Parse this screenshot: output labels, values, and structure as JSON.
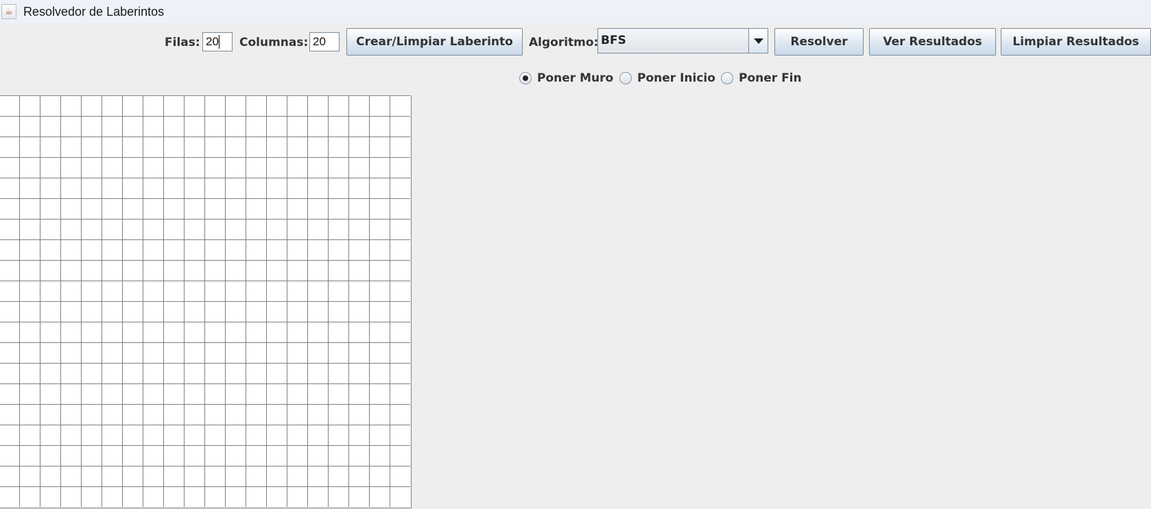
{
  "window": {
    "title": "Resolvedor de Laberintos",
    "icon": "java-cup-icon"
  },
  "toolbar": {
    "rows_label": "Filas:",
    "rows_value": "20",
    "cols_label": "Columnas:",
    "cols_value": "20",
    "create_label": "Crear/Limpiar Laberinto",
    "algo_label": "Algoritmo:",
    "algo_value": "BFS",
    "solve_label": "Resolver",
    "results_label": "Ver Resultados",
    "clear_results_label": "Limpiar Resultados"
  },
  "modes": {
    "selected": "Poner Muro",
    "options": [
      "Poner Muro",
      "Poner Inicio",
      "Poner Fin"
    ]
  },
  "maze": {
    "rows": 20,
    "cols": 20
  }
}
